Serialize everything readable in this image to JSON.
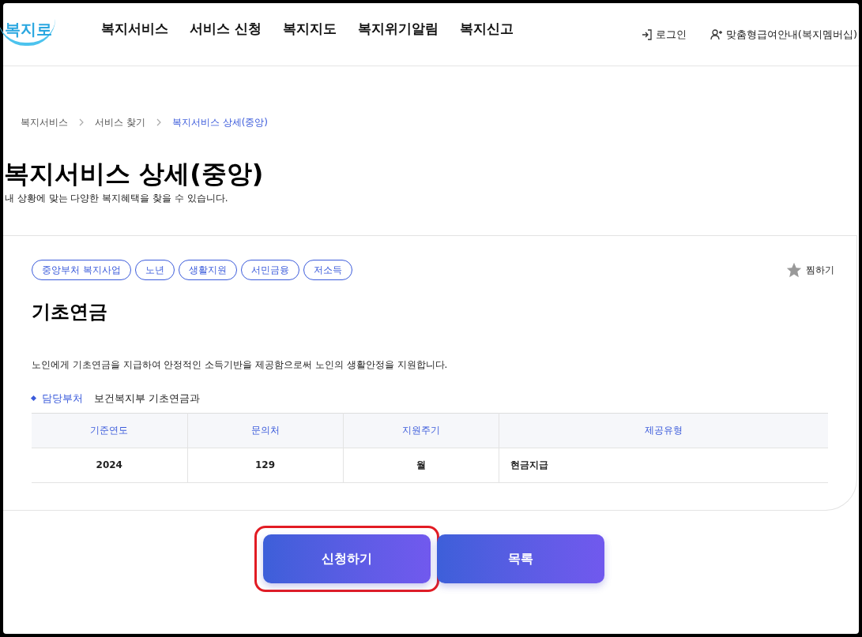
{
  "header": {
    "logo": "복지로",
    "nav": [
      "복지서비스",
      "서비스 신청",
      "복지지도",
      "복지위기알림",
      "복지신고"
    ],
    "login": "로그인",
    "membership": "맞춤형급여안내(복지멤버십)"
  },
  "breadcrumb": [
    {
      "label": "복지서비스",
      "selected": false
    },
    {
      "label": "서비스 찾기",
      "selected": false
    },
    {
      "label": "복지서비스 상세(중앙)",
      "selected": true
    }
  ],
  "page": {
    "title": "복지서비스 상세(중앙)",
    "subtitle": "내 상황에 맞는 다양한 복지혜택을 찾을 수 있습니다."
  },
  "service": {
    "tags": [
      "중앙부처 복지사업",
      "노년",
      "생활지원",
      "서민금융",
      "저소득"
    ],
    "favorite": "찜하기",
    "name": "기초연금",
    "description": "노인에게 기초연금을 지급하여 안정적인 소득기반을 제공함으로써 노인의 생활안정을 지원합니다.",
    "department_label": "담당부처",
    "department": "보건복지부 기초연금과",
    "table": {
      "columns": [
        "기준연도",
        "문의처",
        "지원주기",
        "제공유형"
      ],
      "rows": [
        [
          "2024",
          "129",
          "월",
          "현금지급"
        ]
      ]
    }
  },
  "buttons": [
    {
      "label": "신청하기",
      "highlighted": true
    },
    {
      "label": "목록",
      "highlighted": false
    }
  ]
}
